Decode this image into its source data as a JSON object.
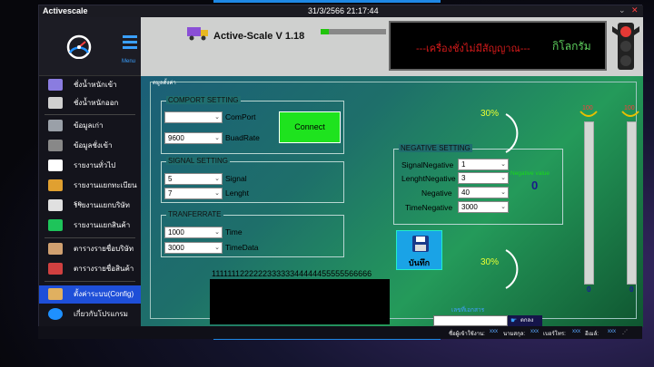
{
  "window": {
    "title": "Activescale",
    "datetime": "31/3/2566 21:17:44"
  },
  "sidebar": {
    "menu_label": "Menu",
    "items": [
      {
        "label": "ชั่งน้ำหนักเข้า",
        "icon": "truck-in-icon",
        "color": "#8a7ce0"
      },
      {
        "label": "ชั่งน้ำหนักออก",
        "icon": "truck-out-icon",
        "color": "#d0d0d0"
      },
      {
        "label": "ข้อมูลเก่า",
        "icon": "database-icon",
        "color": "#9aa0a8"
      },
      {
        "label": "ข้อมูลชั่งเข้า",
        "icon": "scale-icon",
        "color": "#888888"
      },
      {
        "label": "รายงานทั่วไป",
        "icon": "report-icon",
        "color": "#ffffff"
      },
      {
        "label": "รายงานแยกทะเบียนรถ",
        "icon": "car-report-icon",
        "color": "#e0a030"
      },
      {
        "label": "รายงานแยกบริษัท",
        "icon": "company-report-icon",
        "color": "#e0e0e0"
      },
      {
        "label": "รายงานแยกสินค้า",
        "icon": "cart-icon",
        "color": "#1ec45a"
      },
      {
        "label": "ตารางรายชื่อบริษัท",
        "icon": "people-icon",
        "color": "#d0a070"
      },
      {
        "label": "ตารางรายชื่อสินค้า",
        "icon": "download-icon",
        "color": "#d04040"
      },
      {
        "label": "ตั้งค่าระบบ(Config)",
        "icon": "config-hand-icon",
        "color": "#e0b060"
      },
      {
        "label": "เกี่ยวกับโปรแกรม",
        "icon": "help-icon",
        "color": "#1e90ff"
      }
    ]
  },
  "header": {
    "app_title": "Active-Scale V 1.18",
    "progress": 0.12,
    "display_message": "---เครื่องชั่งไม่มีสัญญาณ---",
    "display_unit": "กิโลกรัม"
  },
  "main": {
    "frame_label": "ตมูลตั้งค่า",
    "comport": {
      "title": "COMPORT SETTING",
      "port_label": "ComPort",
      "port_value": "",
      "baud_label": "BuadRate",
      "baud_value": "9600",
      "connect_label": "Connect"
    },
    "signal": {
      "title": "SIGNAL SETTING",
      "signal_label": "Signal",
      "signal_value": "5",
      "length_label": "Lenght",
      "length_value": "7"
    },
    "transfer": {
      "title": "TRANFERRATE",
      "time_label": "Time",
      "time_value": "1000",
      "timedata_label": "TimeData",
      "timedata_value": "3000"
    },
    "digits": "111111122222233333344444455555566666",
    "negative": {
      "title": "NEGATIVE SETTING",
      "rows": [
        {
          "label": "SignalNegative",
          "value": "1"
        },
        {
          "label": "LenghtNegative",
          "value": "3"
        },
        {
          "label": "Negative",
          "value": "40"
        },
        {
          "label": "TimeNegative",
          "value": "3000"
        }
      ],
      "value_label": "Negative value",
      "value": "0"
    },
    "gauge_top_pct": "30%",
    "gauge_bottom_pct": "30%",
    "save_label": "บันทึก",
    "search_label": "เลขที่เอกสาร",
    "search_value": "",
    "search_button": "ตกลง",
    "bars": [
      {
        "top": "100",
        "bottom": "0",
        "level": 0
      },
      {
        "top": "100",
        "bottom": "0",
        "level": 0
      }
    ]
  },
  "status": {
    "user_label": "ชื่อผู้เข้าใช้งาน:",
    "user_value": "xxx",
    "name_label": "นามสกุล:",
    "name_value": "xxx",
    "phone_label": "เบอร์โทร:",
    "phone_value": "xxx",
    "email_label": "อีเมล์:",
    "email_value": "xxx"
  }
}
